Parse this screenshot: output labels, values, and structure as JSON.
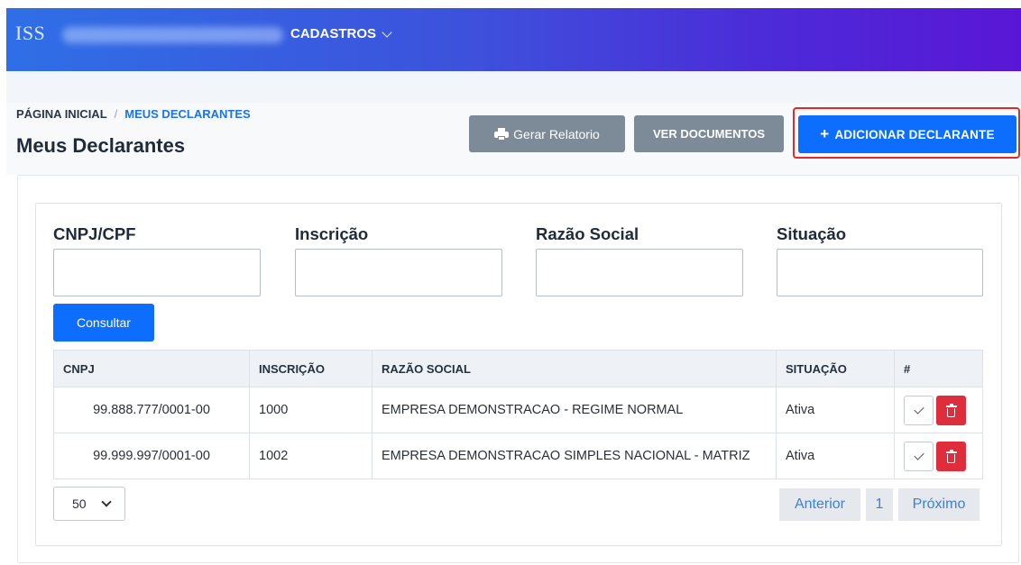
{
  "header": {
    "brand": "ISS",
    "menu": {
      "label": "CADASTROS"
    }
  },
  "breadcrumb": {
    "home": "PÁGINA INICIAL",
    "separator": "/",
    "current": "MEUS DECLARANTES"
  },
  "page": {
    "title": "Meus Declarantes"
  },
  "toolbar": {
    "report_label": "Gerar Relatorio",
    "docs_label": "VER DOCUMENTOS",
    "add_label": "ADICIONAR DECLARANTE",
    "add_icon": "+"
  },
  "filters": {
    "cnpj": {
      "label": "CNPJ/CPF",
      "value": ""
    },
    "inscricao": {
      "label": "Inscrição",
      "value": ""
    },
    "razao": {
      "label": "Razão Social",
      "value": ""
    },
    "situacao": {
      "label": "Situação",
      "value": ""
    },
    "submit_label": "Consultar"
  },
  "table": {
    "columns": [
      "CNPJ",
      "INSCRIÇÃO",
      "RAZÃO SOCIAL",
      "SITUAÇÃO",
      "#"
    ],
    "rows": [
      {
        "cnpj": "99.888.777/0001-00",
        "inscricao": "1000",
        "razao": "EMPRESA DEMONSTRACAO - REGIME NORMAL",
        "situacao": "Ativa"
      },
      {
        "cnpj": "99.999.997/0001-00",
        "inscricao": "1002",
        "razao": "EMPRESA DEMONSTRACAO SIMPLES NACIONAL - MATRIZ",
        "situacao": "Ativa"
      }
    ]
  },
  "pagination": {
    "page_size": "50",
    "prev": "Anterior",
    "current": "1",
    "next": "Próximo"
  },
  "colors": {
    "primary": "#0d6efd",
    "secondary": "#7d8b99",
    "danger": "#e02d3c",
    "highlight_border": "#e02b2b"
  }
}
